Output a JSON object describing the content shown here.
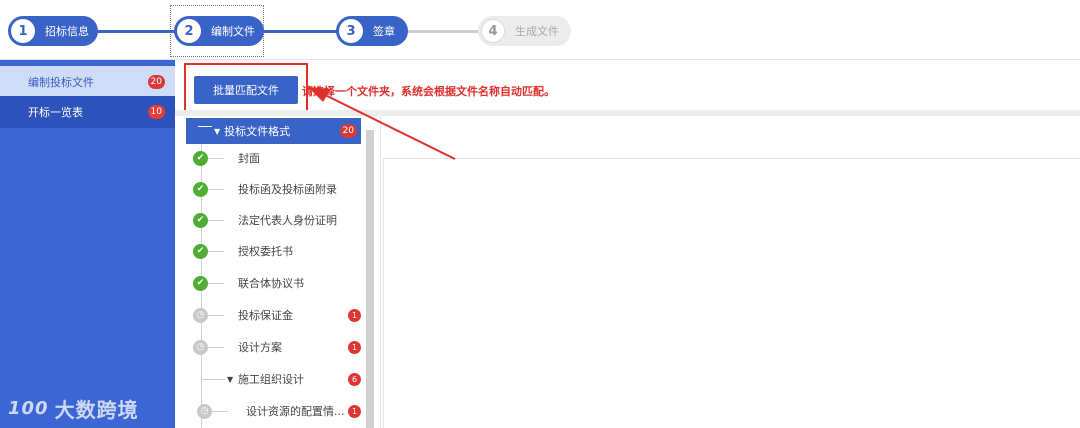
{
  "stepper": {
    "steps": [
      {
        "num": "1",
        "label": "招标信息",
        "state": "active"
      },
      {
        "num": "2",
        "label": "编制文件",
        "state": "active"
      },
      {
        "num": "3",
        "label": "签章",
        "state": "active"
      },
      {
        "num": "4",
        "label": "生成文件",
        "state": "inactive"
      }
    ]
  },
  "sidebar": {
    "items": [
      {
        "label": "编制投标文件",
        "badge": "20"
      },
      {
        "label": "开标一览表",
        "badge": "10"
      }
    ],
    "brand": "大数跨境",
    "brand_logo": "100"
  },
  "toolbar": {
    "batch_button": "批量匹配文件",
    "hint": "请选择一个文件夹，系统会根据文件名称自动匹配。"
  },
  "tree": {
    "root": {
      "label": "投标文件格式",
      "badge": "20"
    },
    "rows": [
      {
        "label": "封面",
        "status": "done",
        "count": ""
      },
      {
        "label": "投标函及投标函附录",
        "status": "done",
        "count": ""
      },
      {
        "label": "法定代表人身份证明",
        "status": "done",
        "count": ""
      },
      {
        "label": "授权委托书",
        "status": "done",
        "count": ""
      },
      {
        "label": "联合体协议书",
        "status": "done",
        "count": ""
      },
      {
        "label": "投标保证金",
        "status": "pending",
        "count": "1"
      },
      {
        "label": "设计方案",
        "status": "pending",
        "count": "1"
      },
      {
        "label": "施工组织设计",
        "status": "group",
        "count": "6"
      },
      {
        "label": "设计资源的配置情...",
        "status": "pending",
        "count": "1"
      }
    ]
  },
  "colors": {
    "primary": "#3a63c8",
    "sidebar": "#3c66d4",
    "danger": "#e0302b",
    "success": "#4fad35"
  }
}
